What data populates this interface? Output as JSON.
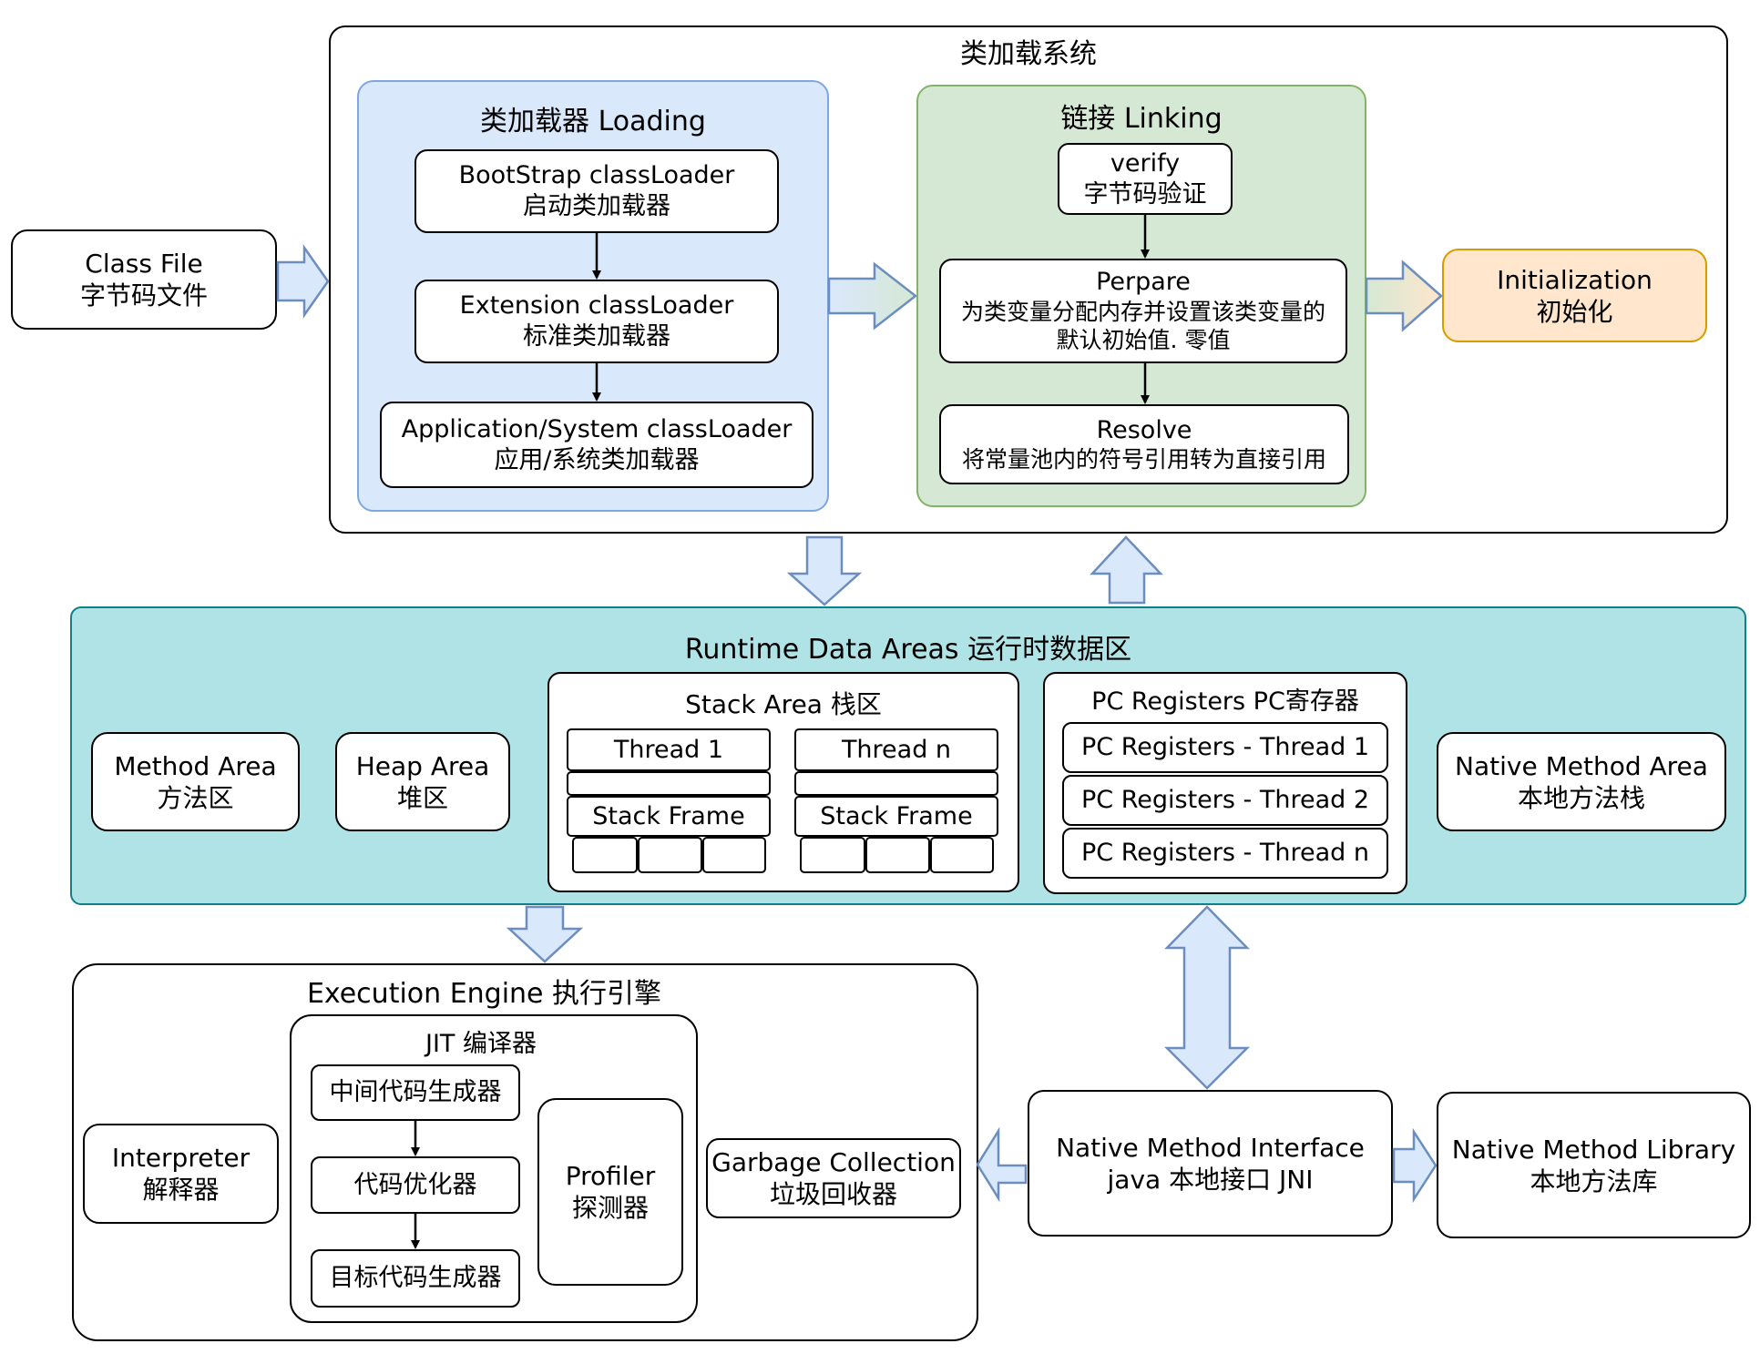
{
  "class_loading_system": {
    "title": "类加载系统",
    "loading": {
      "title": "类加载器 Loading",
      "bootstrap": {
        "line1": "BootStrap classLoader",
        "line2": "启动类加载器"
      },
      "extension": {
        "line1": "Extension classLoader",
        "line2": "标准类加载器"
      },
      "application": {
        "line1": "Application/System classLoader",
        "line2": "应用/系统类加载器"
      }
    },
    "linking": {
      "title": "链接 Linking",
      "verify": {
        "line1": "verify",
        "line2": "字节码验证"
      },
      "prepare": {
        "line1": "Perpare",
        "line2": "为类变量分配内存并设置该类变量的",
        "line3": "默认初始值. 零值"
      },
      "resolve": {
        "line1": "Resolve",
        "line2": "将常量池内的符号引用转为直接引用"
      }
    }
  },
  "class_file": {
    "line1": "Class File",
    "line2": "字节码文件"
  },
  "initialization": {
    "line1": "Initialization",
    "line2": "初始化"
  },
  "runtime_data_areas": {
    "title": "Runtime Data Areas 运行时数据区",
    "method_area": {
      "line1": "Method Area",
      "line2": "方法区"
    },
    "heap_area": {
      "line1": "Heap Area",
      "line2": "堆区"
    },
    "stack_area": {
      "title": "Stack Area 栈区",
      "thread1": "Thread 1",
      "threadn": "Thread n",
      "stack_frame": "Stack Frame"
    },
    "pc_registers": {
      "title": "PC Registers PC寄存器",
      "items": [
        "PC Registers - Thread 1",
        "PC Registers - Thread 2",
        "PC Registers - Thread n"
      ]
    },
    "native_method_area": {
      "line1": "Native Method Area",
      "line2": "本地方法栈"
    }
  },
  "execution_engine": {
    "title": "Execution Engine 执行引擎",
    "interpreter": {
      "line1": "Interpreter",
      "line2": "解释器"
    },
    "jit": {
      "title": "JIT 编译器",
      "steps": [
        "中间代码生成器",
        "代码优化器",
        "目标代码生成器"
      ],
      "profiler": {
        "line1": "Profiler",
        "line2": "探测器"
      }
    },
    "gc": {
      "line1": "Garbage Collection",
      "line2": "垃圾回收器"
    }
  },
  "native_interface": {
    "line1": "Native Method Interface",
    "line2": "java 本地接口 JNI"
  },
  "native_library": {
    "line1": "Native Method Library",
    "line2": "本地方法库"
  },
  "colors": {
    "loading_fill": "#dae8fc",
    "loading_stroke": "#7ea6e0",
    "linking_fill": "#d5e8d4",
    "linking_stroke": "#82b366",
    "runtime_fill": "#b0e3e6",
    "runtime_stroke": "#0e8088",
    "init_fill": "#ffe6cc",
    "init_stroke": "#d79b00",
    "arrow_fill": "#dae8fc",
    "arrow_stroke": "#6c8ebf"
  }
}
